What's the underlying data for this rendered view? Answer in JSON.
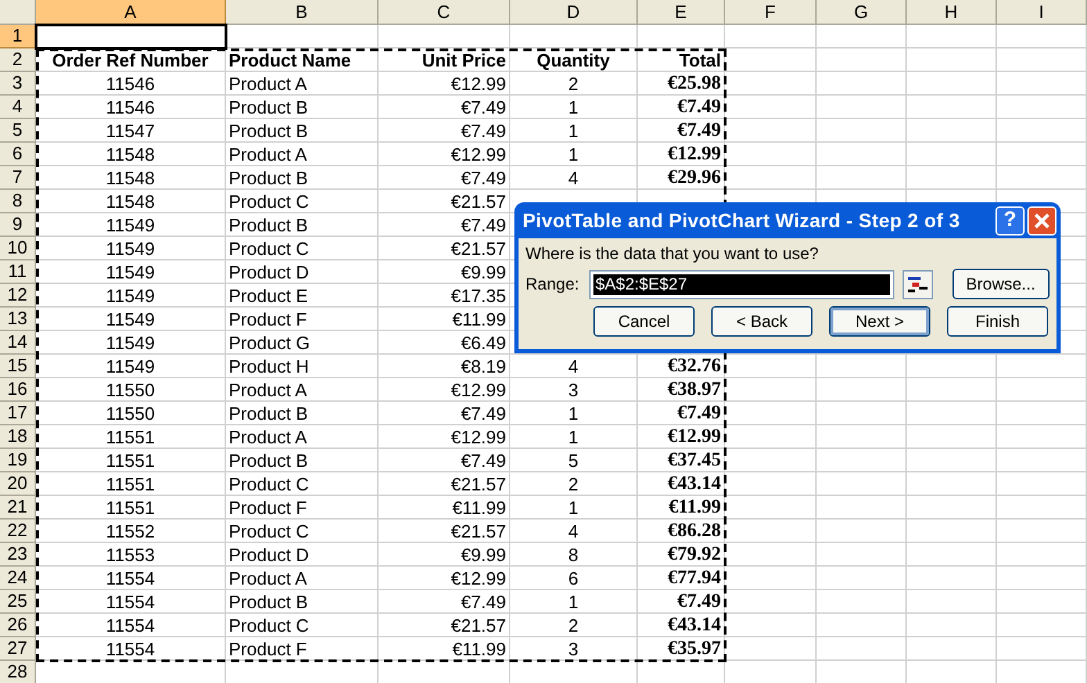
{
  "sheet": {
    "columns": [
      {
        "label": "A",
        "selected": true
      },
      {
        "label": "B",
        "selected": false
      },
      {
        "label": "C",
        "selected": false
      },
      {
        "label": "D",
        "selected": false
      },
      {
        "label": "E",
        "selected": false
      },
      {
        "label": "F",
        "selected": false
      },
      {
        "label": "G",
        "selected": false
      },
      {
        "label": "H",
        "selected": false
      },
      {
        "label": "I",
        "selected": false
      }
    ],
    "rows": [
      {
        "number": "1",
        "selected": true
      },
      {
        "number": "2",
        "selected": false,
        "kind": "header",
        "order": "Order Ref Number",
        "product": "Product Name",
        "price": "Unit Price",
        "quantity": "Quantity",
        "total": "Total"
      },
      {
        "number": "3",
        "selected": false,
        "kind": "data",
        "order": "11546",
        "product": "Product A",
        "price": "€12.99",
        "quantity": "2",
        "total": "€25.98"
      },
      {
        "number": "4",
        "selected": false,
        "kind": "data",
        "order": "11546",
        "product": "Product B",
        "price": "€7.49",
        "quantity": "1",
        "total": "€7.49"
      },
      {
        "number": "5",
        "selected": false,
        "kind": "data",
        "order": "11547",
        "product": "Product B",
        "price": "€7.49",
        "quantity": "1",
        "total": "€7.49"
      },
      {
        "number": "6",
        "selected": false,
        "kind": "data",
        "order": "11548",
        "product": "Product A",
        "price": "€12.99",
        "quantity": "1",
        "total": "€12.99"
      },
      {
        "number": "7",
        "selected": false,
        "kind": "data",
        "order": "11548",
        "product": "Product B",
        "price": "€7.49",
        "quantity": "4",
        "total": "€29.96"
      },
      {
        "number": "8",
        "selected": false,
        "kind": "data",
        "order": "11548",
        "product": "Product C",
        "price": "€21.57"
      },
      {
        "number": "9",
        "selected": false,
        "kind": "data",
        "order": "11549",
        "product": "Product B",
        "price": "€7.49"
      },
      {
        "number": "10",
        "selected": false,
        "kind": "data",
        "order": "11549",
        "product": "Product C",
        "price": "€21.57"
      },
      {
        "number": "11",
        "selected": false,
        "kind": "data",
        "order": "11549",
        "product": "Product D",
        "price": "€9.99"
      },
      {
        "number": "12",
        "selected": false,
        "kind": "data",
        "order": "11549",
        "product": "Product E",
        "price": "€17.35"
      },
      {
        "number": "13",
        "selected": false,
        "kind": "data",
        "order": "11549",
        "product": "Product F",
        "price": "€11.99"
      },
      {
        "number": "14",
        "selected": false,
        "kind": "data",
        "order": "11549",
        "product": "Product G",
        "price": "€6.49"
      },
      {
        "number": "15",
        "selected": false,
        "kind": "data",
        "order": "11549",
        "product": "Product H",
        "price": "€8.19",
        "quantity": "4",
        "total": "€32.76"
      },
      {
        "number": "16",
        "selected": false,
        "kind": "data",
        "order": "11550",
        "product": "Product A",
        "price": "€12.99",
        "quantity": "3",
        "total": "€38.97"
      },
      {
        "number": "17",
        "selected": false,
        "kind": "data",
        "order": "11550",
        "product": "Product B",
        "price": "€7.49",
        "quantity": "1",
        "total": "€7.49"
      },
      {
        "number": "18",
        "selected": false,
        "kind": "data",
        "order": "11551",
        "product": "Product A",
        "price": "€12.99",
        "quantity": "1",
        "total": "€12.99"
      },
      {
        "number": "19",
        "selected": false,
        "kind": "data",
        "order": "11551",
        "product": "Product B",
        "price": "€7.49",
        "quantity": "5",
        "total": "€37.45"
      },
      {
        "number": "20",
        "selected": false,
        "kind": "data",
        "order": "11551",
        "product": "Product C",
        "price": "€21.57",
        "quantity": "2",
        "total": "€43.14"
      },
      {
        "number": "21",
        "selected": false,
        "kind": "data",
        "order": "11551",
        "product": "Product F",
        "price": "€11.99",
        "quantity": "1",
        "total": "€11.99"
      },
      {
        "number": "22",
        "selected": false,
        "kind": "data",
        "order": "11552",
        "product": "Product C",
        "price": "€21.57",
        "quantity": "4",
        "total": "€86.28"
      },
      {
        "number": "23",
        "selected": false,
        "kind": "data",
        "order": "11553",
        "product": "Product D",
        "price": "€9.99",
        "quantity": "8",
        "total": "€79.92"
      },
      {
        "number": "24",
        "selected": false,
        "kind": "data",
        "order": "11554",
        "product": "Product A",
        "price": "€12.99",
        "quantity": "6",
        "total": "€77.94"
      },
      {
        "number": "25",
        "selected": false,
        "kind": "data",
        "order": "11554",
        "product": "Product B",
        "price": "€7.49",
        "quantity": "1",
        "total": "€7.49"
      },
      {
        "number": "26",
        "selected": false,
        "kind": "data",
        "order": "11554",
        "product": "Product C",
        "price": "€21.57",
        "quantity": "2",
        "total": "€43.14"
      },
      {
        "number": "27",
        "selected": false,
        "kind": "data",
        "order": "11554",
        "product": "Product F",
        "price": "€11.99",
        "quantity": "3",
        "total": "€35.97"
      },
      {
        "number": "28",
        "selected": false
      }
    ]
  },
  "dialog": {
    "title": "PivotTable and PivotChart Wizard - Step 2 of 3",
    "help_button": "?",
    "prompt": "Where is the data that you want to use?",
    "range_label": "Range:",
    "range_value": "$A$2:$E$27",
    "browse_button": "Browse...",
    "buttons": [
      {
        "label": "Cancel",
        "selected": false
      },
      {
        "label": "< Back",
        "selected": false
      },
      {
        "label": "Next >",
        "selected": true
      },
      {
        "label": "Finish",
        "selected": false
      }
    ]
  }
}
